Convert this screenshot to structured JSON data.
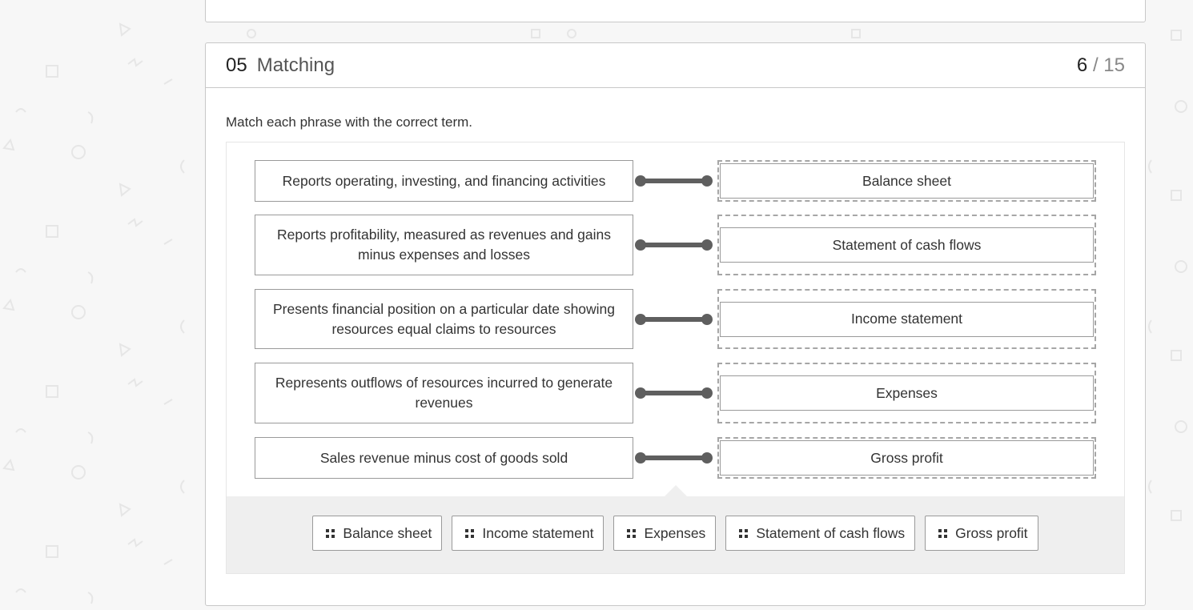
{
  "question": {
    "number": "05",
    "type": "Matching",
    "progress_current": "6",
    "progress_separator": "/",
    "progress_total": "15",
    "instructions": "Match each phrase with the correct term."
  },
  "matches": [
    {
      "phrase": "Reports operating, investing, and financing activities",
      "term": "Balance sheet"
    },
    {
      "phrase": "Reports profitability, measured as revenues and gains minus expenses and losses",
      "term": "Statement of cash flows"
    },
    {
      "phrase": "Presents financial position on a particular date showing resources equal claims to resources",
      "term": "Income statement"
    },
    {
      "phrase": "Represents outflows of resources incurred to generate revenues",
      "term": "Expenses"
    },
    {
      "phrase": "Sales revenue minus cost of goods sold",
      "term": "Gross profit"
    }
  ],
  "term_bank": [
    {
      "label": "Balance sheet",
      "icon": "drag-handle-icon"
    },
    {
      "label": "Income statement",
      "icon": "drag-handle-icon"
    },
    {
      "label": "Expenses",
      "icon": "drag-handle-icon"
    },
    {
      "label": "Statement of cash flows",
      "icon": "drag-handle-icon"
    },
    {
      "label": "Gross profit",
      "icon": "drag-handle-icon"
    }
  ],
  "colors": {
    "background": "#f7f7f7",
    "border": "#9a9a9a",
    "connector": "#5f5f5f",
    "bank": "#efefef"
  }
}
